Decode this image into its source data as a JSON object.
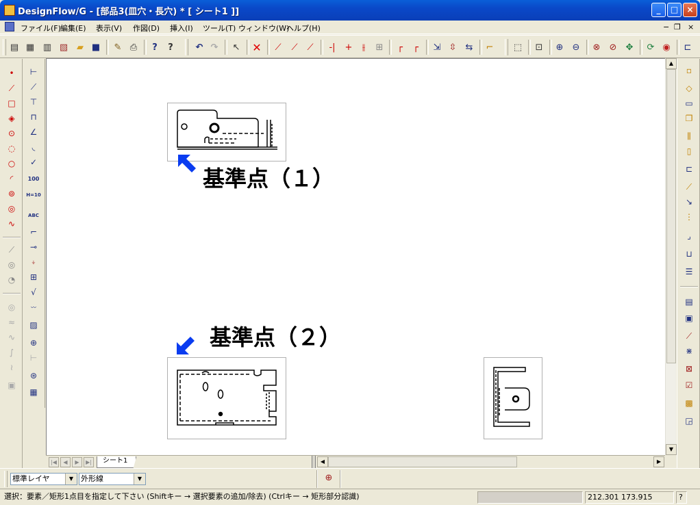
{
  "window": {
    "title": "DesignFlow/G - [部品3(皿穴・長穴) * [ シート1 ]]",
    "minimize": "_",
    "maximize": "□",
    "close": "×"
  },
  "menu": {
    "items": [
      "ファイル(F)",
      "編集(E)",
      "表示(V)",
      "作図(D)",
      "挿入(I)",
      "ツール(T)",
      "ウィンドウ(W)",
      "ヘルプ(H)"
    ],
    "mdi_minimize": "−",
    "mdi_restore": "❐",
    "mdi_close": "×"
  },
  "canvas": {
    "label1": "基準点（１）",
    "label2": "基準点（２）",
    "arrow_color": "#0a3cf0"
  },
  "sheet_tabs": [
    "シート1"
  ],
  "layer": {
    "layer_value": "標準レイヤ",
    "linetype_value": "外形線"
  },
  "status": {
    "message": "選択：要素／矩形1点目を指定して下さい (Shiftキー → 選択要素の追加/除去) (Ctrlキー → 矩形部分認識)",
    "coords": "212.301  173.915",
    "help": "?"
  },
  "icons": {
    "arrow_up": "▲",
    "arrow_down": "▼",
    "arrow_left": "◀",
    "arrow_right": "▶",
    "first": "|◀",
    "last": "▶|"
  }
}
